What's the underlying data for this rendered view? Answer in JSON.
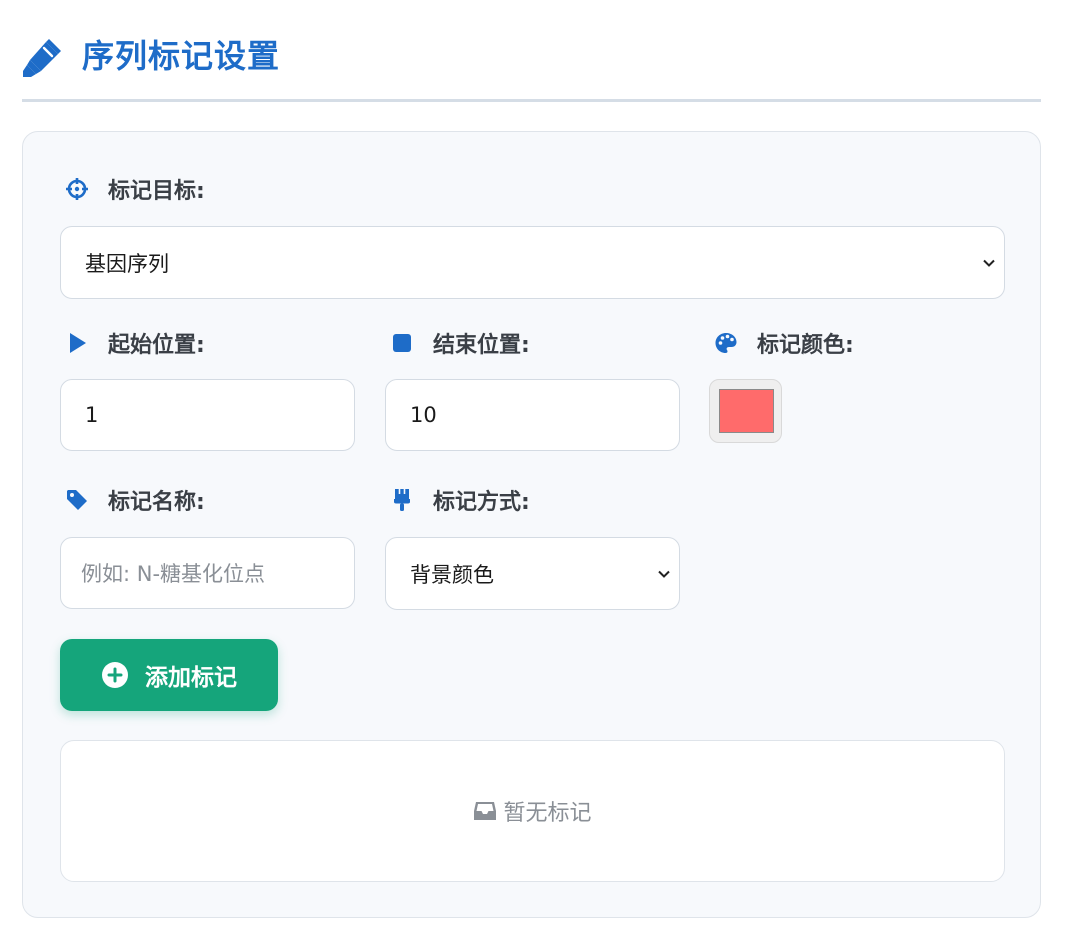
{
  "header": {
    "title": "序列标记设置",
    "icon": "highlighter-icon"
  },
  "target": {
    "label": "标记目标:",
    "icon": "crosshairs-icon",
    "selected": "基因序列"
  },
  "start": {
    "label": "起始位置:",
    "icon": "play-icon",
    "value": "1"
  },
  "end": {
    "label": "结束位置:",
    "icon": "stop-icon",
    "value": "10"
  },
  "color": {
    "label": "标记颜色:",
    "icon": "palette-icon",
    "value": "#ff6b6b"
  },
  "name": {
    "label": "标记名称:",
    "icon": "tag-icon",
    "placeholder": "例如: N-糖基化位点"
  },
  "method": {
    "label": "标记方式:",
    "icon": "paint-brush-icon",
    "selected": "背景颜色"
  },
  "add_button": {
    "label": "添加标记",
    "icon": "plus-circle-icon"
  },
  "empty": {
    "text": "暂无标记",
    "icon": "inbox-icon"
  },
  "colors": {
    "accent": "#1e6cc8",
    "button": "#15a57b",
    "panel_bg": "#f7f9fc"
  }
}
